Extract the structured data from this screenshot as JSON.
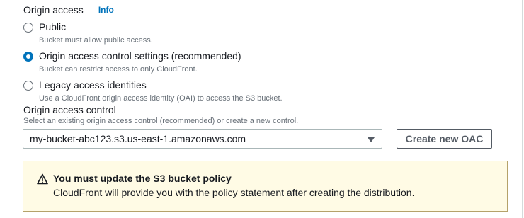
{
  "origin_access": {
    "label": "Origin access",
    "info_link": "Info",
    "options": [
      {
        "label": "Public",
        "description": "Bucket must allow public access.",
        "selected": false
      },
      {
        "label": "Origin access control settings (recommended)",
        "description": "Bucket can restrict access to only CloudFront.",
        "selected": true
      },
      {
        "label": "Legacy access identities",
        "description": "Use a CloudFront origin access identity (OAI) to access the S3 bucket.",
        "selected": false
      }
    ]
  },
  "origin_access_control": {
    "label": "Origin access control",
    "description": "Select an existing origin access control (recommended) or create a new control.",
    "selected_value": "my-bucket-abc123.s3.us-east-1.amazonaws.com",
    "create_button": "Create new OAC"
  },
  "alert": {
    "type": "warning",
    "icon": "warning-icon",
    "title": "You must update the S3 bucket policy",
    "body": "CloudFront will provide you with the policy statement after creating the distribution."
  },
  "colors": {
    "accent": "#0073bb",
    "warning_bg": "#fffbe5",
    "warning_border": "#b5a26a"
  }
}
